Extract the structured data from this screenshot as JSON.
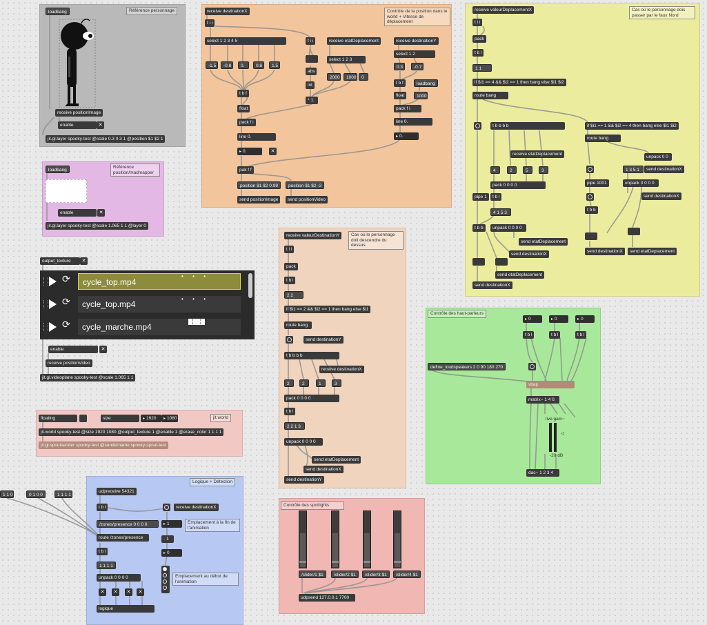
{
  "colors": {
    "grey_panel": "#b9b9b9",
    "pink_panel": "#e4b8e4",
    "orange_panel": "#f2c59c",
    "yellow_panel": "#ecec9e",
    "peach_panel": "#f0d4bd",
    "green_panel": "#a8e89a",
    "blue_panel": "#b7c8f2",
    "red_panel": "#f0b7b3",
    "salmon_panel": "#f2c8c5",
    "object": "#3a3a3a",
    "wire": "#9a9a9a"
  },
  "ref_perso": {
    "loadbang": "loadbang",
    "comment": "Référence personnage",
    "receive": "receive positionImage",
    "enable": "enable",
    "layer": "jit.gl.layer spooky-test @scale 0.3 0.3 1 @position $1 $2 1"
  },
  "ref_madmapper": {
    "loadbang": "loadbang",
    "comment": "Référence position/madmapper",
    "enable": "enable",
    "layer": "jit.gl.layer spooky-test @scale 1.065 1 1 @layer 0"
  },
  "output_texture": "output_texture",
  "playlist": {
    "items": [
      "cycle_top.mp4",
      "cycle_top.mp4",
      "cycle_marche.mp4"
    ]
  },
  "videoplane": {
    "enable": "enable",
    "receive": "receive positionVideo",
    "plane": "jit.gl.videoplane spooky-test @scale 1.065 1 1"
  },
  "world": {
    "floating": "floating",
    "size": "size",
    "w": "1920",
    "h": "1080",
    "label": "jit.world",
    "world": "jit.world spooky-test @size 1920 1080 @output_texture 1 @enable 1 @erase_color 1 1 1 1",
    "spout": "jit.gl.spoutsender spooky-test @sendername spooky-spout-test"
  },
  "controle": {
    "comment": "Contrôle de la position dans le world + Vitesse de déplacement",
    "receiveX": "receive destinationX",
    "tii": "t i i",
    "select": "select 1 2 3 4 5",
    "vals": [
      "-1.5",
      "-0.8",
      "0.",
      "0.8",
      "1.5"
    ],
    "tbf": "t b f",
    "float": "float",
    "packfi": "pack f i",
    "line": "line 0.",
    "n0": "0.",
    "pakff": "pak f f",
    "posimg": "position $1 $2 0.99",
    "posvid": "position $1 $2 -2",
    "sendimg": "send positionImage",
    "sendvid": "send positionVideo",
    "tii2": "t i i",
    "minus": "-",
    "abs": "abs",
    "int": "int",
    "mul": "* 1.",
    "recvEtat": "receive etatDeplacement",
    "select123": "select 1 2 3",
    "n2000": "2000",
    "n1000": "1000",
    "n0b": "0",
    "recvY": "receive destinationY",
    "select12": "select 1 2",
    "v03": "0.3",
    "vm07": "-0.7",
    "tbf2": "t b f",
    "float2": "float",
    "loadbang": "loadbang",
    "n1000b": "1000",
    "packfi2": "pack f i",
    "line2": "line 0.",
    "n0c": "0."
  },
  "nord": {
    "comment": "Cas où le personnage dois passer par le faux Nord",
    "receive": "receive valeurDeplacementX",
    "tii": "t i i",
    "pack": "pack",
    "tbl": "t b l",
    "msg11": "1 1",
    "if1": "if $i1 == 4 && $i2 == 1 then bang else $i1 $i2",
    "route": "route bang",
    "tbbbb": "t b b b b",
    "recvEtat": "receive etatDeplacement",
    "m4": "4",
    "m2": "2",
    "m5": "5",
    "m3": "3",
    "pack0000": "pack 0 0 0 0",
    "pipe1": "pipe 1",
    "tbl2": "t b l",
    "m4153": "4 1 5 3",
    "tbb": "t b b",
    "unpack": "unpack 0 0 0 0",
    "sendEtat1": "send etatDeplacement",
    "sendX1": "send destinationX",
    "sendEtat2": "send etatDeplacement",
    "sendX2": "send destinationX",
    "if2": "if $i1 == 1 && $i2 == 4 then bang else $i1 $i2",
    "route2": "route bang",
    "unpack00": "unpack 0 0",
    "sendX3": "send destinationX",
    "pipe1001": "pipe 1001",
    "m1351": "1 3 5 1",
    "unpack2": "unpack 0 0 0 0",
    "sendX4": "send destinationX",
    "tbb2": "t b b",
    "sendX5": "send destinationX",
    "sendEtat3": "send etatDeplacement"
  },
  "dessus": {
    "comment": "Cas où le personnage doit descendre du dessus",
    "receive": "receive valeurDestinationY",
    "tii": "t i i",
    "pack": "pack",
    "tbl": "t b l",
    "m22": "2 2",
    "if": "if $i1 == 2 && $i2 == 1 then bang else $i1",
    "route": "route bang",
    "sendY": "send destinationY",
    "tbbbb": "t b b b b",
    "recvX": "receive destinationX",
    "m2": "2",
    "m2b": "2",
    "m1": "1",
    "m3": "3",
    "pack0000": "pack 0 0 0 0",
    "tbl2": "t b l",
    "m2213": "2 2 1 3",
    "unpack": "unpack 0 0 0 0",
    "sendEtat": "send etatDeplacement",
    "sendX": "send destinationX",
    "sendY2": "send destinationY"
  },
  "hp": {
    "comment": "Contrôle des haut-parleurs",
    "n1": "0",
    "n2": "0",
    "n3": "0",
    "define": "define_loudspeakers 2 0 90 180 270",
    "vbap": "vbap",
    "matrix": "matrix~ 1 4 0.",
    "gain": "live.gain~",
    "db": "-20 dB",
    "dac": "dac~ 1 2 3 4",
    "tbl": "t b l"
  },
  "detection": {
    "comment": "Logique + Détection",
    "m110": "1 1 0",
    "m0100": "0 1 0 0",
    "m1111": "1 1 1 1",
    "udp": "udpreceive 54321",
    "tbl": "t b l",
    "zones": "/zones/presence 0 0 0 0",
    "route": "route /zones/presence",
    "tbl2": "t b l",
    "m1111b": "1 1 1 1",
    "unpack": "unpack 0 0 0 0",
    "logique": "logique",
    "recvX": "receive destinationX",
    "n1": "1",
    "minus1": "- 1",
    "n0": "0",
    "empl_fin": "Emplacement à la fin de l'animation",
    "empl_debut": "Emplacement au début de l'animation"
  },
  "spots": {
    "comment": "Contrôle des spotlights",
    "s1": "/slider/1 $1",
    "s2": "/slider/2 $1",
    "s3": "/slider/3 $1",
    "s4": "/slider/4 $1",
    "udpsend": "udpsend 127.0.0.1 7700"
  }
}
